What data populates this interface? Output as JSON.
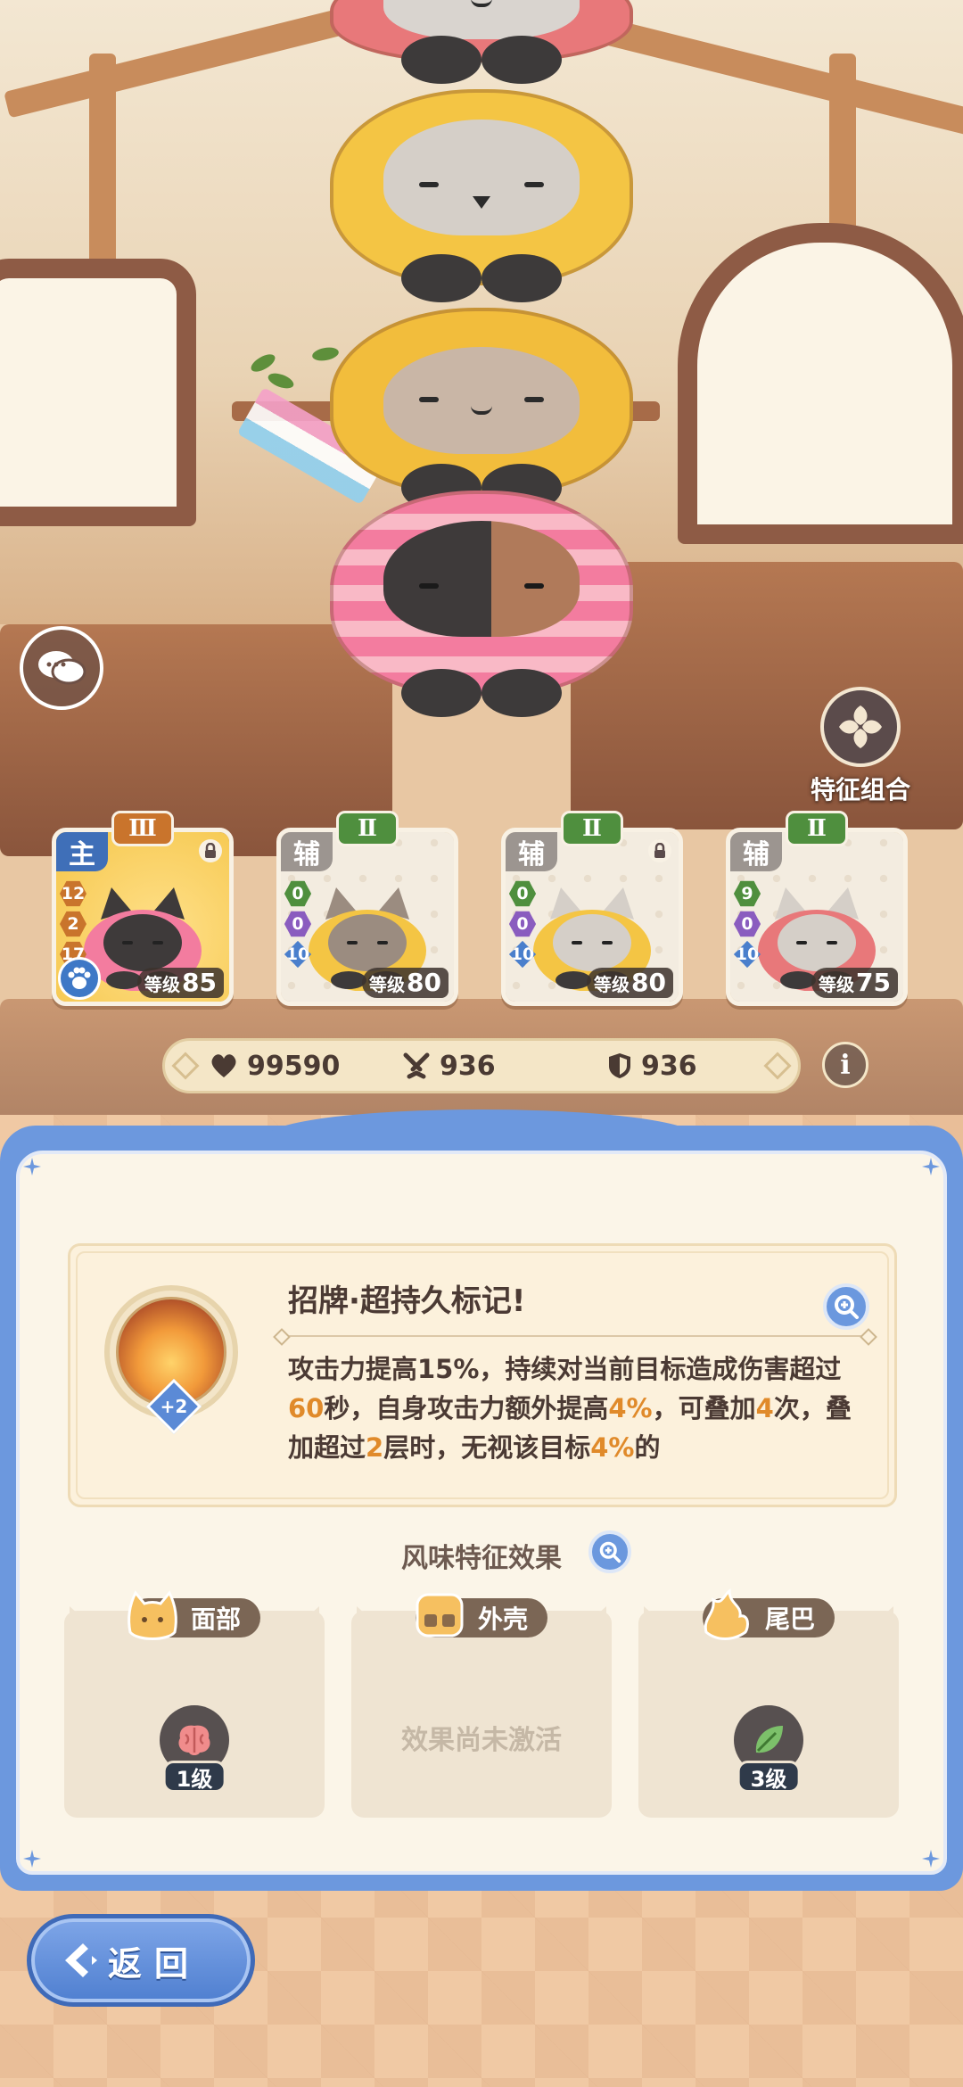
{
  "chat": {
    "icon": "chat-bubbles-icon"
  },
  "trait_combo": {
    "label": "特征组合",
    "icon": "four-petal-icon"
  },
  "team": [
    {
      "role": "主",
      "rank": "Ⅲ",
      "role_color": "#3f6fb8",
      "rank_color": "#c9742c",
      "bg_color": "#f5c64a",
      "stats": [
        "12",
        "2",
        "17"
      ],
      "level_label": "等级",
      "level": "85",
      "locked": true,
      "has_paw_badge": true
    },
    {
      "role": "辅",
      "rank": "Ⅱ",
      "role_color": "#9c9590",
      "rank_color": "#4f8f3e",
      "bg_color": "#f3ece0",
      "stats": [
        "0",
        "0",
        "10"
      ],
      "level_label": "等级",
      "level": "80",
      "locked": false,
      "has_paw_badge": false
    },
    {
      "role": "辅",
      "rank": "Ⅱ",
      "role_color": "#9c9590",
      "rank_color": "#4f8f3e",
      "bg_color": "#f3ece0",
      "stats": [
        "0",
        "0",
        "10"
      ],
      "level_label": "等级",
      "level": "80",
      "locked": true,
      "has_paw_badge": false
    },
    {
      "role": "辅",
      "rank": "Ⅱ",
      "role_color": "#9c9590",
      "rank_color": "#4f8f3e",
      "bg_color": "#f3ece0",
      "stats": [
        "9",
        "0",
        "10"
      ],
      "level_label": "等级",
      "level": "75",
      "locked": false,
      "has_paw_badge": false
    }
  ],
  "stats_bar": {
    "hp": {
      "icon": "heart-icon",
      "value": "99590"
    },
    "attack": {
      "icon": "crossed-swords-icon",
      "value": "936"
    },
    "defense": {
      "icon": "shield-icon",
      "value": "936"
    }
  },
  "info": {
    "label": "i"
  },
  "skill": {
    "title": "招牌·超持久标记!",
    "plus": "+2",
    "description": [
      {
        "t": "攻击力提高15%，持续对当前目标造成伤害超过"
      },
      {
        "t": "60",
        "hl": true
      },
      {
        "t": "秒，自身攻击力额外提高"
      },
      {
        "t": "4%",
        "hl": true
      },
      {
        "t": "，可叠加"
      },
      {
        "t": "4",
        "hl": true
      },
      {
        "t": "次，叠加超过"
      },
      {
        "t": "2",
        "hl": true
      },
      {
        "t": "层时，无视该目标"
      },
      {
        "t": "4%",
        "hl": true
      },
      {
        "t": "的"
      }
    ]
  },
  "flavor": {
    "title": "风味特征效果"
  },
  "traits": [
    {
      "label": "面部",
      "icon": "cat-face-icon",
      "badge_icon": "brain-icon",
      "level": "1级",
      "active": true
    },
    {
      "label": "外壳",
      "icon": "shell-icon",
      "empty_text": "效果尚未激活",
      "active": false
    },
    {
      "label": "尾巴",
      "icon": "flame-tail-icon",
      "badge_icon": "leaf-icon",
      "level": "3级",
      "active": true
    }
  ],
  "back": {
    "label": "返回"
  },
  "colors": {
    "accent_blue": "#6c98de",
    "highlight_orange": "#e08a2a",
    "text_dark": "#4b3a34"
  }
}
